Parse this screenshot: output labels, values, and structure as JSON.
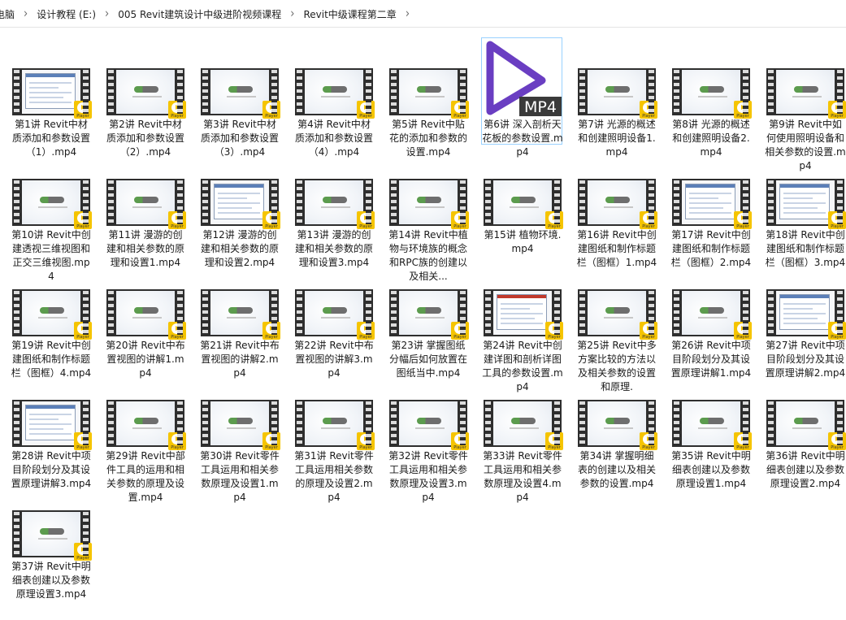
{
  "breadcrumb": [
    "电脑",
    "设计教程 (E:)",
    "005 Revit建筑设计中级进阶视频课程",
    "Revit中级课程第二章"
  ],
  "icons": {
    "breadcrumb_separator": "chevron-right-icon",
    "video_badge": "player-play-icon",
    "mp4_file": "mp4-play-icon"
  },
  "badge_text": "Player",
  "mp4_icon_text": "MP4",
  "colors": {
    "selection_border": "#99d1ff",
    "badge_yellow": "#f5c400",
    "mp4_purple": "#6a3ec2"
  },
  "files": [
    {
      "name": "第1讲 Revit中材质添加和参数设置（1）.mp4",
      "thumb": "screen"
    },
    {
      "name": "第2讲 Revit中材质添加和参数设置（2）.mp4",
      "thumb": "logo"
    },
    {
      "name": "第3讲 Revit中材质添加和参数设置（3）.mp4",
      "thumb": "logo"
    },
    {
      "name": "第4讲 Revit中材质添加和参数设置（4）.mp4",
      "thumb": "logo"
    },
    {
      "name": "第5讲 Revit中贴花的添加和参数的设置.mp4",
      "thumb": "logo"
    },
    {
      "name": "第6讲 深入剖析天花板的参数设置.mp4",
      "thumb": "mp4",
      "selected": true
    },
    {
      "name": "第7讲 光源的概述和创建照明设备1.mp4",
      "thumb": "logo"
    },
    {
      "name": "第8讲 光源的概述和创建照明设备2.mp4",
      "thumb": "logo"
    },
    {
      "name": "第9讲 Revit中如何使用照明设备和相关参数的设置.mp4",
      "thumb": "logo"
    },
    {
      "name": "第10讲 Revit中创建透视三维视图和正交三维视图.mp4",
      "thumb": "logo"
    },
    {
      "name": "第11讲 漫游的创建和相关参数的原理和设置1.mp4",
      "thumb": "logo"
    },
    {
      "name": "第12讲 漫游的创建和相关参数的原理和设置2.mp4",
      "thumb": "screen"
    },
    {
      "name": "第13讲 漫游的创建和相关参数的原理和设置3.mp4",
      "thumb": "logo"
    },
    {
      "name": "第14讲 Revit中植物与环境族的概念和RPC族的创建以及相关...",
      "thumb": "logo"
    },
    {
      "name": "第15讲 植物环境.mp4",
      "thumb": "logo"
    },
    {
      "name": "第16讲 Revit中创建图纸和制作标题栏（图框）1.mp4",
      "thumb": "logo"
    },
    {
      "name": "第17讲 Revit中创建图纸和制作标题栏（图框）2.mp4",
      "thumb": "screen"
    },
    {
      "name": "第18讲 Revit中创建图纸和制作标题栏（图框）3.mp4",
      "thumb": "screen"
    },
    {
      "name": "第19讲 Revit中创建图纸和制作标题栏（图框）4.mp4",
      "thumb": "logo"
    },
    {
      "name": "第20讲 Revit中布置视图的讲解1.mp4",
      "thumb": "logo"
    },
    {
      "name": "第21讲 Revit中布置视图的讲解2.mp4",
      "thumb": "logo"
    },
    {
      "name": "第22讲 Revit中布置视图的讲解3.mp4",
      "thumb": "logo"
    },
    {
      "name": "第23讲 掌握图纸分幅后如何放置在图纸当中.mp4",
      "thumb": "logo"
    },
    {
      "name": "第24讲 Revit中创建详图和剖析详图工具的参数设置.mp4",
      "thumb": "screen-red"
    },
    {
      "name": "第25讲 Revit中多方案比较的方法以及相关参数的设置和原理.",
      "thumb": "logo"
    },
    {
      "name": "第26讲 Revit中项目阶段划分及其设置原理讲解1.mp4",
      "thumb": "logo"
    },
    {
      "name": "第27讲 Revit中项目阶段划分及其设置原理讲解2.mp4",
      "thumb": "screen"
    },
    {
      "name": "第28讲 Revit中项目阶段划分及其设置原理讲解3.mp4",
      "thumb": "screen"
    },
    {
      "name": "第29讲 Revit中部件工具的运用和相关参数的原理及设置.mp4",
      "thumb": "logo"
    },
    {
      "name": "第30讲 Revit零件工具运用和相关参数原理及设置1.mp4",
      "thumb": "logo"
    },
    {
      "name": "第31讲 Revit零件工具运用相关参数的原理及设置2.mp4",
      "thumb": "logo"
    },
    {
      "name": "第32讲 Revit零件工具运用和相关参数原理及设置3.mp4",
      "thumb": "logo"
    },
    {
      "name": "第33讲 Revit零件工具运用和相关参数原理及设置4.mp4",
      "thumb": "logo"
    },
    {
      "name": "第34讲 掌握明细表的创建以及相关参数的设置.mp4",
      "thumb": "logo"
    },
    {
      "name": "第35讲 Revit中明细表创建以及参数原理设置1.mp4",
      "thumb": "logo"
    },
    {
      "name": "第36讲 Revit中明细表创建以及参数原理设置2.mp4",
      "thumb": "logo"
    },
    {
      "name": "第37讲 Revit中明细表创建以及参数原理设置3.mp4",
      "thumb": "logo"
    }
  ]
}
